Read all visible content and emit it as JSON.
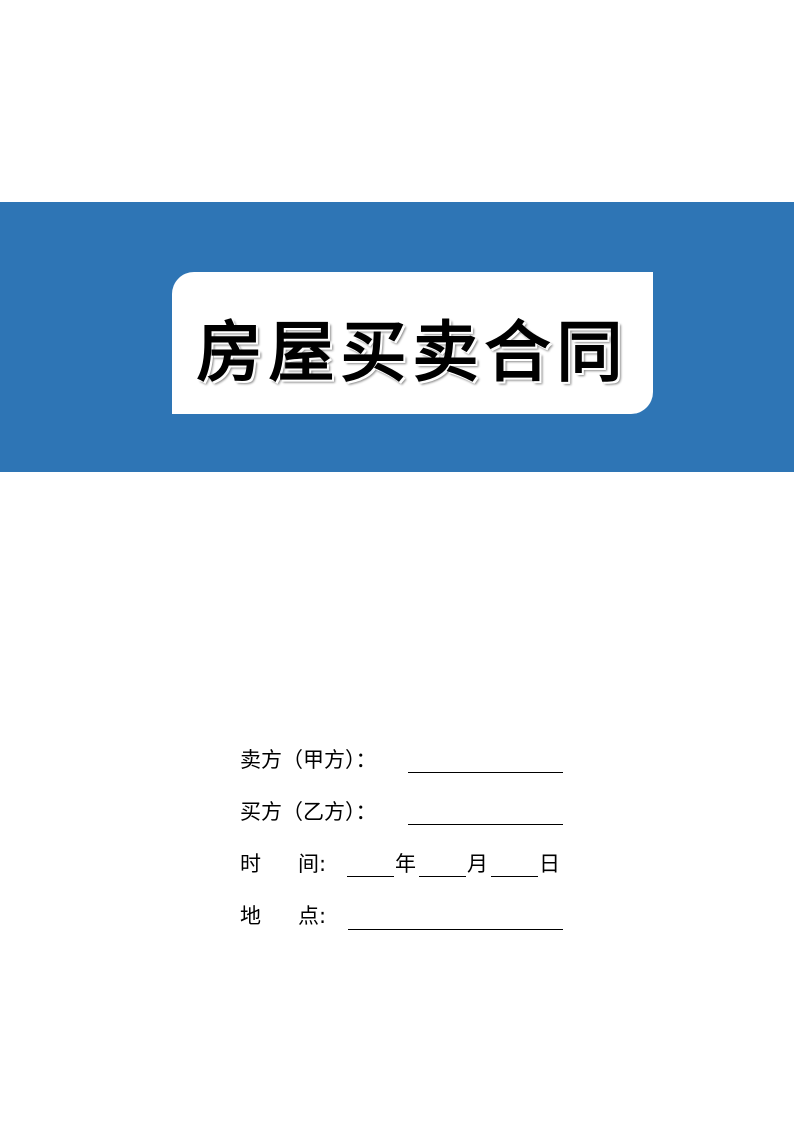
{
  "cover": {
    "title": "房屋买卖合同",
    "band_color": "#2E75B5"
  },
  "form": {
    "seller_label": "卖方（甲方）：",
    "buyer_label": "买方（乙方）：",
    "time_label_1": "时",
    "time_label_2": "间:",
    "year": "年",
    "month": "月",
    "day": "日",
    "place_label_1": "地",
    "place_label_2": "点:",
    "seller_value": "",
    "buyer_value": "",
    "year_value": "",
    "month_value": "",
    "day_value": "",
    "place_value": ""
  }
}
